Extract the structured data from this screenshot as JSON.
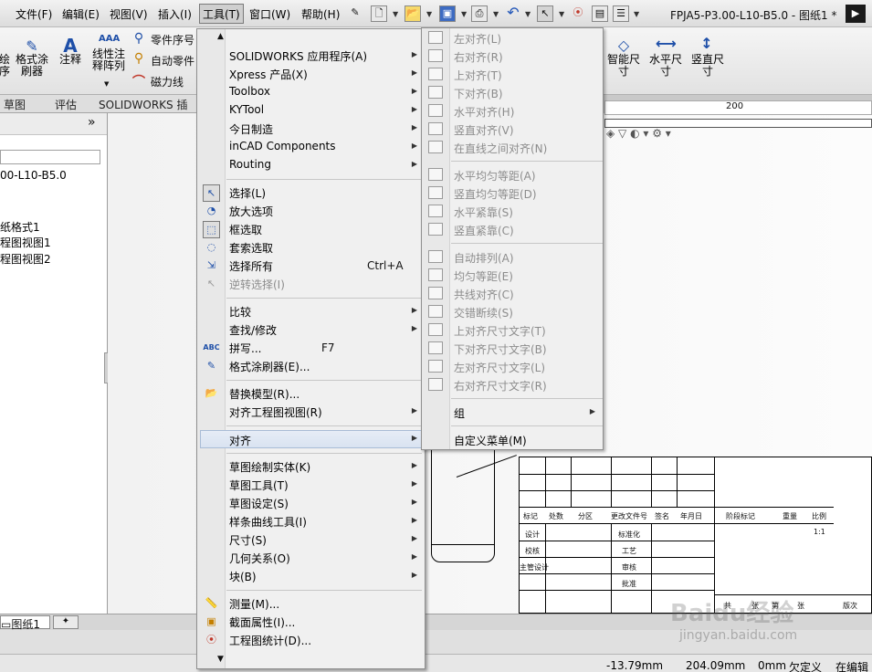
{
  "menubar": {
    "items": [
      "文件(F)",
      "编辑(E)",
      "视图(V)",
      "插入(I)",
      "工具(T)",
      "窗口(W)",
      "帮助(H)"
    ],
    "document_title": "FPJA5-P3.00-L10-B5.0 - 图纸1 *"
  },
  "commands": {
    "left_partial": "绘\n序",
    "format_painter": "格式涂\n刷器",
    "annotation": "注释",
    "linear_pattern": "线性注\n释阵列",
    "balloon": "零件序号",
    "auto_balloon": "自动零件",
    "magnetic_line": "磁力线",
    "smart_dimension": "智能尺\n寸",
    "horizontal_dimension": "水平尺\n寸",
    "vertical_dimension": "竖直尺\n寸"
  },
  "tabs": [
    "草图",
    "评估",
    "SOLIDWORKS 插件"
  ],
  "tree": {
    "root": "00-L10-B5.0",
    "items": [
      "纸格式1",
      "程图视图1",
      "程图视图2"
    ]
  },
  "ruler": {
    "tick_200": "200"
  },
  "sheet_tabs": [
    "图纸1"
  ],
  "tools_menu": {
    "group1": [
      {
        "label": "SOLIDWORKS 应用程序(A)",
        "submenu": true
      },
      {
        "label": "Xpress 产品(X)",
        "submenu": true
      },
      {
        "label": "Toolbox",
        "submenu": true
      },
      {
        "label": "KYTool",
        "submenu": true
      },
      {
        "label": "今日制造",
        "submenu": true
      },
      {
        "label": "inCAD Components",
        "submenu": true
      },
      {
        "label": "Routing",
        "submenu": true
      }
    ],
    "group2": [
      {
        "label": "选择(L)",
        "icon": "select-arrow-icon"
      },
      {
        "label": "放大选项",
        "icon": "magnify-select-icon"
      },
      {
        "label": "框选取",
        "icon": "box-select-icon"
      },
      {
        "label": "套索选取",
        "icon": "lasso-select-icon"
      },
      {
        "label": "选择所有",
        "shortcut": "Ctrl+A",
        "icon": "select-all-icon"
      },
      {
        "label": "逆转选择(I)",
        "disabled": true,
        "icon": "invert-select-icon"
      }
    ],
    "group3": [
      {
        "label": "比较",
        "submenu": true
      },
      {
        "label": "查找/修改",
        "submenu": true
      },
      {
        "label": "拼写...",
        "shortcut": "F7",
        "icon": "spell-check-icon",
        "icon_text": "ABC"
      },
      {
        "label": "格式涂刷器(E)...",
        "icon": "format-painter-icon"
      }
    ],
    "group4": [
      {
        "label": "替换模型(R)...",
        "icon": "replace-model-icon"
      },
      {
        "label": "对齐工程图视图(R)",
        "submenu": true
      }
    ],
    "group5": [
      {
        "label": "对齐",
        "submenu": true,
        "highlighted": true
      }
    ],
    "group6": [
      {
        "label": "草图绘制实体(K)",
        "submenu": true
      },
      {
        "label": "草图工具(T)",
        "submenu": true
      },
      {
        "label": "草图设定(S)",
        "submenu": true
      },
      {
        "label": "样条曲线工具(I)",
        "submenu": true
      },
      {
        "label": "尺寸(S)",
        "submenu": true
      },
      {
        "label": "几何关系(O)",
        "submenu": true
      },
      {
        "label": "块(B)",
        "submenu": true
      }
    ],
    "group7": [
      {
        "label": "测量(M)...",
        "icon": "measure-icon"
      },
      {
        "label": "截面属性(I)...",
        "icon": "section-properties-icon"
      },
      {
        "label": "工程图统计(D)...",
        "icon": "drawing-statistics-icon"
      }
    ]
  },
  "align_submenu": {
    "group1": [
      "左对齐(L)",
      "右对齐(R)",
      "上对齐(T)",
      "下对齐(B)",
      "水平对齐(H)",
      "竖直对齐(V)",
      "在直线之间对齐(N)"
    ],
    "group2": [
      "水平均匀等距(A)",
      "竖直均匀等距(D)",
      "水平紧靠(S)",
      "竖直紧靠(C)"
    ],
    "group3": [
      "自动排列(A)",
      "均匀等距(E)",
      "共线对齐(C)",
      "交错断续(S)",
      "上对齐尺寸文字(T)",
      "下对齐尺寸文字(B)",
      "左对齐尺寸文字(L)",
      "右对齐尺寸文字(R)"
    ],
    "group_item": "组",
    "customize": "自定义菜单(M)"
  },
  "title_block": {
    "row_labels": [
      "标记",
      "处数",
      "分区",
      "更改文件号",
      "签名",
      "年月日"
    ],
    "col_labels": [
      "设计",
      "校核",
      "主管设计"
    ],
    "mid_labels": [
      "标准化",
      "工艺",
      "审核",
      "批准"
    ],
    "right_header": [
      "阶段标记",
      "重量",
      "比例"
    ],
    "scale_value": "1:1",
    "sheet_labels": [
      "共",
      "张",
      "第",
      "张"
    ],
    "version": "版次"
  },
  "status": {
    "x": "-13.79mm",
    "y": "204.09mm",
    "z": "0mm",
    "state": "欠定义",
    "mode": "在编辑"
  },
  "watermark": {
    "logo": "Baidu经验",
    "url": "jingyan.baidu.com"
  }
}
